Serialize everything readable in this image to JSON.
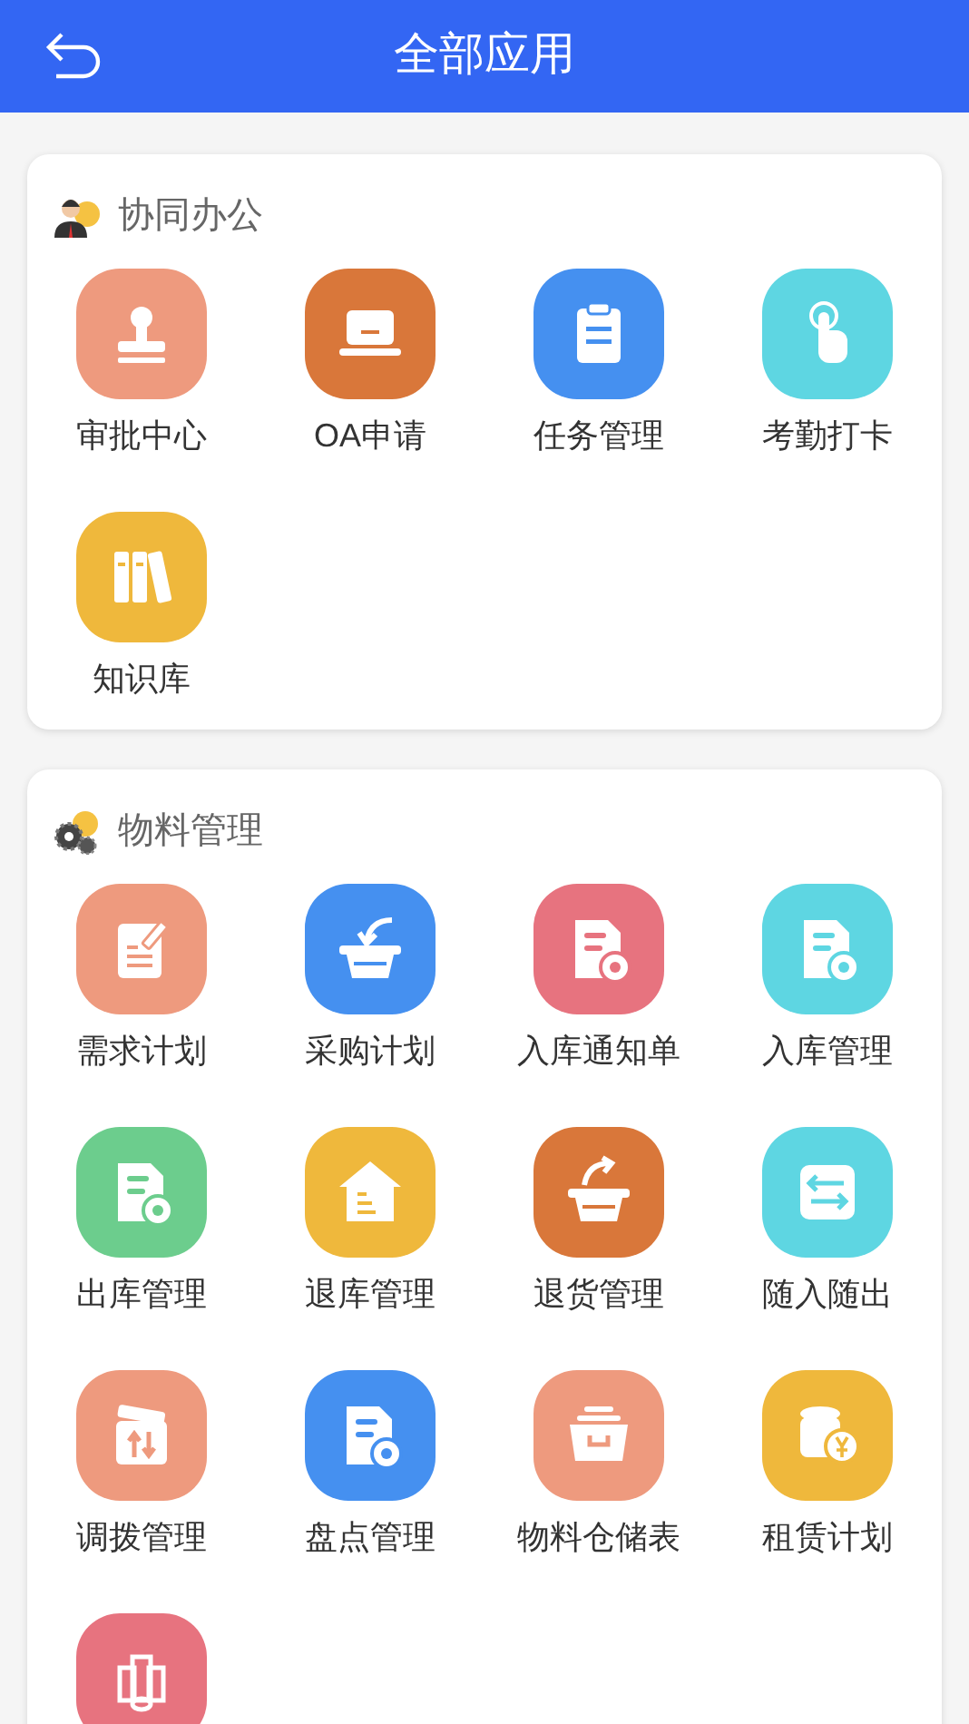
{
  "header": {
    "title": "全部应用"
  },
  "sections": [
    {
      "title": "协同办公",
      "kind": "person",
      "items": [
        {
          "label": "审批中心",
          "kind": "stamp",
          "color": "#ee9a7e"
        },
        {
          "label": "OA申请",
          "kind": "laptop",
          "color": "#d9773a"
        },
        {
          "label": "任务管理",
          "kind": "clipboard",
          "color": "#4590f0"
        },
        {
          "label": "考勤打卡",
          "kind": "touch",
          "color": "#5ed6e2"
        },
        {
          "label": "知识库",
          "kind": "books",
          "color": "#efb83c"
        }
      ]
    },
    {
      "title": "物料管理",
      "kind": "gears",
      "items": [
        {
          "label": "需求计划",
          "kind": "note",
          "color": "#ee9a7e"
        },
        {
          "label": "采购计划",
          "kind": "basket",
          "color": "#4590f0"
        },
        {
          "label": "入库通知单",
          "kind": "docgear",
          "color": "#e7737f"
        },
        {
          "label": "入库管理",
          "kind": "docback",
          "color": "#5ed6e2"
        },
        {
          "label": "出库管理",
          "kind": "docout",
          "color": "#6ccd8d"
        },
        {
          "label": "退库管理",
          "kind": "house",
          "color": "#efb83c"
        },
        {
          "label": "退货管理",
          "kind": "basketup",
          "color": "#d9773a"
        },
        {
          "label": "随入随出",
          "kind": "swap",
          "color": "#5ed6e2"
        },
        {
          "label": "调拨管理",
          "kind": "transfer",
          "color": "#ee9a7e"
        },
        {
          "label": "盘点管理",
          "kind": "doccheck",
          "color": "#4590f0"
        },
        {
          "label": "物料仓储表",
          "kind": "box",
          "color": "#ee9a7e"
        },
        {
          "label": "租赁计划",
          "kind": "coins",
          "color": "#efb83c"
        },
        {
          "kind": "pipes",
          "color": "#e7737f"
        }
      ]
    }
  ]
}
